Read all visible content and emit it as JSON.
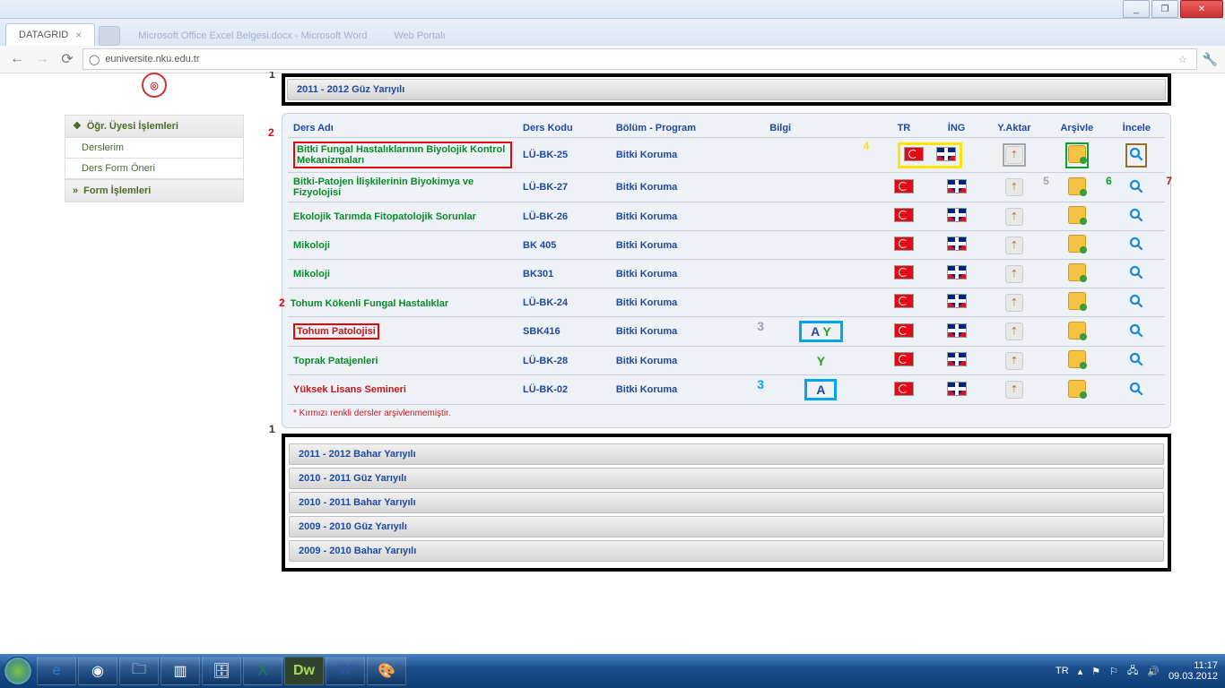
{
  "titlebar": {
    "min": "_",
    "max": "❐",
    "close": "✕"
  },
  "tab": {
    "title": "DATAGRID"
  },
  "ghost_tabs": [
    "Microsoft Office Excel Belgesi.docx - Microsoft Word",
    "Web Portalı"
  ],
  "url": "euniversite.nku.edu.tr",
  "sidebar": {
    "head1": "Öğr. Üyesi İşlemleri",
    "items": [
      "Derslerim",
      "Ders Form Öneri"
    ],
    "head2": "Form İşlemleri"
  },
  "markers": {
    "one": "1",
    "two": "2",
    "three": "3",
    "four": "4",
    "five": "5",
    "six": "6",
    "seven": "7"
  },
  "open_semester": "2011 - 2012 Güz Yarıyılı",
  "headers": {
    "ders": "Ders Adı",
    "kod": "Ders Kodu",
    "prog": "Bölüm - Program",
    "bilgi": "Bilgi",
    "tr": "TR",
    "ing": "İNG",
    "ya": "Y.Aktar",
    "ar": "Arşivle",
    "in": "İncele"
  },
  "rows": [
    {
      "name": "Bitki Fungal Hastalıklarının Biyolojik Kontrol Mekanizmaları",
      "kod": "LÜ-BK-25",
      "prog": "Bitki Koruma",
      "bilgi": "",
      "cls": "ders",
      "box_name": true,
      "row1": true
    },
    {
      "name": "Bitki-Patojen İlişkilerinin Biyokimya ve Fizyolojisi",
      "kod": "LÜ-BK-27",
      "prog": "Bitki Koruma",
      "bilgi": "",
      "cls": "ders"
    },
    {
      "name": "Ekolojik Tarımda Fitopatolojik Sorunlar",
      "kod": "LÜ-BK-26",
      "prog": "Bitki Koruma",
      "bilgi": "",
      "cls": "ders"
    },
    {
      "name": "Mikoloji",
      "kod": "BK 405",
      "prog": "Bitki Koruma",
      "bilgi": "",
      "cls": "ders"
    },
    {
      "name": "Mikoloji",
      "kod": "BK301",
      "prog": "Bitki Koruma",
      "bilgi": "",
      "cls": "ders"
    },
    {
      "name": "Tohum Kökenli Fungal Hastalıklar",
      "kod": "LÜ-BK-24",
      "prog": "Bitki Koruma",
      "bilgi": "",
      "cls": "ders",
      "marker2": true
    },
    {
      "name": "Tohum Patolojisi",
      "kod": "SBK416",
      "prog": "Bitki Koruma",
      "bilgi": "AY",
      "cls": "ders-red",
      "box_name": true,
      "box_bilgi": true,
      "bilgi_marker": "a"
    },
    {
      "name": "Toprak Patajenleri",
      "kod": "LÜ-BK-28",
      "prog": "Bitki Koruma",
      "bilgi": "Y",
      "cls": "ders"
    },
    {
      "name": "Yüksek Lisans Semineri",
      "kod": "LÜ-BK-02",
      "prog": "Bitki Koruma",
      "bilgi": "A",
      "cls": "ders-red",
      "box_bilgi": true,
      "bilgi_marker": "b"
    }
  ],
  "footnote": "* Kırmızı renkli dersler arşivlenmemiştir.",
  "semesters": [
    "2011 - 2012 Bahar Yarıyılı",
    "2010 - 2011 Güz Yarıyılı",
    "2010 - 2011 Bahar Yarıyılı",
    "2009 - 2010 Güz Yarıyılı",
    "2009 - 2010 Bahar Yarıyılı"
  ],
  "tray": {
    "lang": "TR",
    "time": "11:17",
    "date": "09.03.2012"
  }
}
